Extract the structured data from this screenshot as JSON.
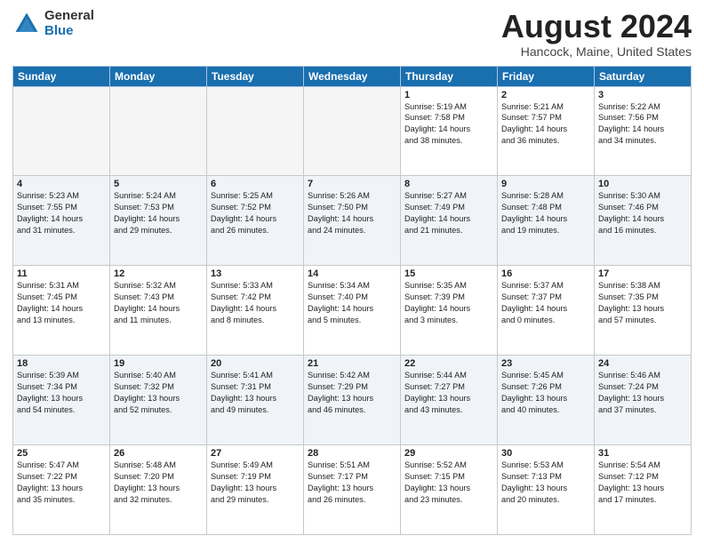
{
  "logo": {
    "general": "General",
    "blue": "Blue"
  },
  "title": "August 2024",
  "location": "Hancock, Maine, United States",
  "days_of_week": [
    "Sunday",
    "Monday",
    "Tuesday",
    "Wednesday",
    "Thursday",
    "Friday",
    "Saturday"
  ],
  "weeks": [
    {
      "days": [
        {
          "num": "",
          "info": ""
        },
        {
          "num": "",
          "info": ""
        },
        {
          "num": "",
          "info": ""
        },
        {
          "num": "",
          "info": ""
        },
        {
          "num": "1",
          "info": "Sunrise: 5:19 AM\nSunset: 7:58 PM\nDaylight: 14 hours\nand 38 minutes."
        },
        {
          "num": "2",
          "info": "Sunrise: 5:21 AM\nSunset: 7:57 PM\nDaylight: 14 hours\nand 36 minutes."
        },
        {
          "num": "3",
          "info": "Sunrise: 5:22 AM\nSunset: 7:56 PM\nDaylight: 14 hours\nand 34 minutes."
        }
      ]
    },
    {
      "days": [
        {
          "num": "4",
          "info": "Sunrise: 5:23 AM\nSunset: 7:55 PM\nDaylight: 14 hours\nand 31 minutes."
        },
        {
          "num": "5",
          "info": "Sunrise: 5:24 AM\nSunset: 7:53 PM\nDaylight: 14 hours\nand 29 minutes."
        },
        {
          "num": "6",
          "info": "Sunrise: 5:25 AM\nSunset: 7:52 PM\nDaylight: 14 hours\nand 26 minutes."
        },
        {
          "num": "7",
          "info": "Sunrise: 5:26 AM\nSunset: 7:50 PM\nDaylight: 14 hours\nand 24 minutes."
        },
        {
          "num": "8",
          "info": "Sunrise: 5:27 AM\nSunset: 7:49 PM\nDaylight: 14 hours\nand 21 minutes."
        },
        {
          "num": "9",
          "info": "Sunrise: 5:28 AM\nSunset: 7:48 PM\nDaylight: 14 hours\nand 19 minutes."
        },
        {
          "num": "10",
          "info": "Sunrise: 5:30 AM\nSunset: 7:46 PM\nDaylight: 14 hours\nand 16 minutes."
        }
      ]
    },
    {
      "days": [
        {
          "num": "11",
          "info": "Sunrise: 5:31 AM\nSunset: 7:45 PM\nDaylight: 14 hours\nand 13 minutes."
        },
        {
          "num": "12",
          "info": "Sunrise: 5:32 AM\nSunset: 7:43 PM\nDaylight: 14 hours\nand 11 minutes."
        },
        {
          "num": "13",
          "info": "Sunrise: 5:33 AM\nSunset: 7:42 PM\nDaylight: 14 hours\nand 8 minutes."
        },
        {
          "num": "14",
          "info": "Sunrise: 5:34 AM\nSunset: 7:40 PM\nDaylight: 14 hours\nand 5 minutes."
        },
        {
          "num": "15",
          "info": "Sunrise: 5:35 AM\nSunset: 7:39 PM\nDaylight: 14 hours\nand 3 minutes."
        },
        {
          "num": "16",
          "info": "Sunrise: 5:37 AM\nSunset: 7:37 PM\nDaylight: 14 hours\nand 0 minutes."
        },
        {
          "num": "17",
          "info": "Sunrise: 5:38 AM\nSunset: 7:35 PM\nDaylight: 13 hours\nand 57 minutes."
        }
      ]
    },
    {
      "days": [
        {
          "num": "18",
          "info": "Sunrise: 5:39 AM\nSunset: 7:34 PM\nDaylight: 13 hours\nand 54 minutes."
        },
        {
          "num": "19",
          "info": "Sunrise: 5:40 AM\nSunset: 7:32 PM\nDaylight: 13 hours\nand 52 minutes."
        },
        {
          "num": "20",
          "info": "Sunrise: 5:41 AM\nSunset: 7:31 PM\nDaylight: 13 hours\nand 49 minutes."
        },
        {
          "num": "21",
          "info": "Sunrise: 5:42 AM\nSunset: 7:29 PM\nDaylight: 13 hours\nand 46 minutes."
        },
        {
          "num": "22",
          "info": "Sunrise: 5:44 AM\nSunset: 7:27 PM\nDaylight: 13 hours\nand 43 minutes."
        },
        {
          "num": "23",
          "info": "Sunrise: 5:45 AM\nSunset: 7:26 PM\nDaylight: 13 hours\nand 40 minutes."
        },
        {
          "num": "24",
          "info": "Sunrise: 5:46 AM\nSunset: 7:24 PM\nDaylight: 13 hours\nand 37 minutes."
        }
      ]
    },
    {
      "days": [
        {
          "num": "25",
          "info": "Sunrise: 5:47 AM\nSunset: 7:22 PM\nDaylight: 13 hours\nand 35 minutes."
        },
        {
          "num": "26",
          "info": "Sunrise: 5:48 AM\nSunset: 7:20 PM\nDaylight: 13 hours\nand 32 minutes."
        },
        {
          "num": "27",
          "info": "Sunrise: 5:49 AM\nSunset: 7:19 PM\nDaylight: 13 hours\nand 29 minutes."
        },
        {
          "num": "28",
          "info": "Sunrise: 5:51 AM\nSunset: 7:17 PM\nDaylight: 13 hours\nand 26 minutes."
        },
        {
          "num": "29",
          "info": "Sunrise: 5:52 AM\nSunset: 7:15 PM\nDaylight: 13 hours\nand 23 minutes."
        },
        {
          "num": "30",
          "info": "Sunrise: 5:53 AM\nSunset: 7:13 PM\nDaylight: 13 hours\nand 20 minutes."
        },
        {
          "num": "31",
          "info": "Sunrise: 5:54 AM\nSunset: 7:12 PM\nDaylight: 13 hours\nand 17 minutes."
        }
      ]
    }
  ]
}
